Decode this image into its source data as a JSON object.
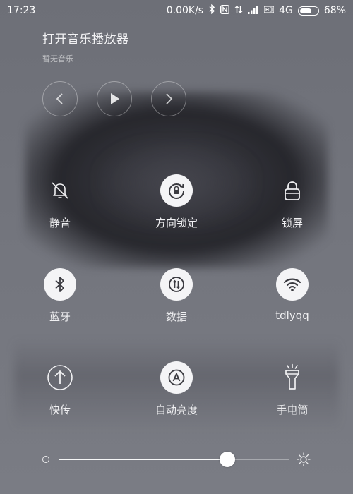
{
  "status_bar": {
    "time": "17:23",
    "net_speed": "0.00K/s",
    "carrier": "4G",
    "battery_percent_text": "68%",
    "battery_level": 0.68,
    "icons": [
      "bluetooth-icon",
      "nfc-icon",
      "data-arrows-icon",
      "signal-bars-icon",
      "hd-icon",
      "battery-icon"
    ]
  },
  "music": {
    "title": "打开音乐播放器",
    "subtitle": "暂无音乐",
    "controls": [
      "previous-icon",
      "play-icon",
      "next-icon"
    ]
  },
  "toggles": [
    {
      "label": "静音",
      "icon": "bell-off-icon",
      "active": false
    },
    {
      "label": "方向锁定",
      "icon": "rotation-lock-icon",
      "active": true
    },
    {
      "label": "锁屏",
      "icon": "lock-icon",
      "active": false
    },
    {
      "label": "蓝牙",
      "icon": "bluetooth-icon",
      "active": true
    },
    {
      "label": "数据",
      "icon": "mobile-data-icon",
      "active": true
    },
    {
      "label": "tdlyqq",
      "icon": "wifi-icon",
      "active": true
    },
    {
      "label": "快传",
      "icon": "upload-icon",
      "active": false
    },
    {
      "label": "自动亮度",
      "icon": "auto-brightness-icon",
      "active": true
    },
    {
      "label": "手电筒",
      "icon": "flashlight-icon",
      "active": false
    }
  ],
  "brightness": {
    "level": 0.73,
    "min_icon": "brightness-low-icon",
    "max_icon": "brightness-high-icon"
  },
  "colors": {
    "active_bg": "#f4f4f6",
    "active_icon": "#3a3a40",
    "inactive_icon": "#f0f0f2"
  }
}
